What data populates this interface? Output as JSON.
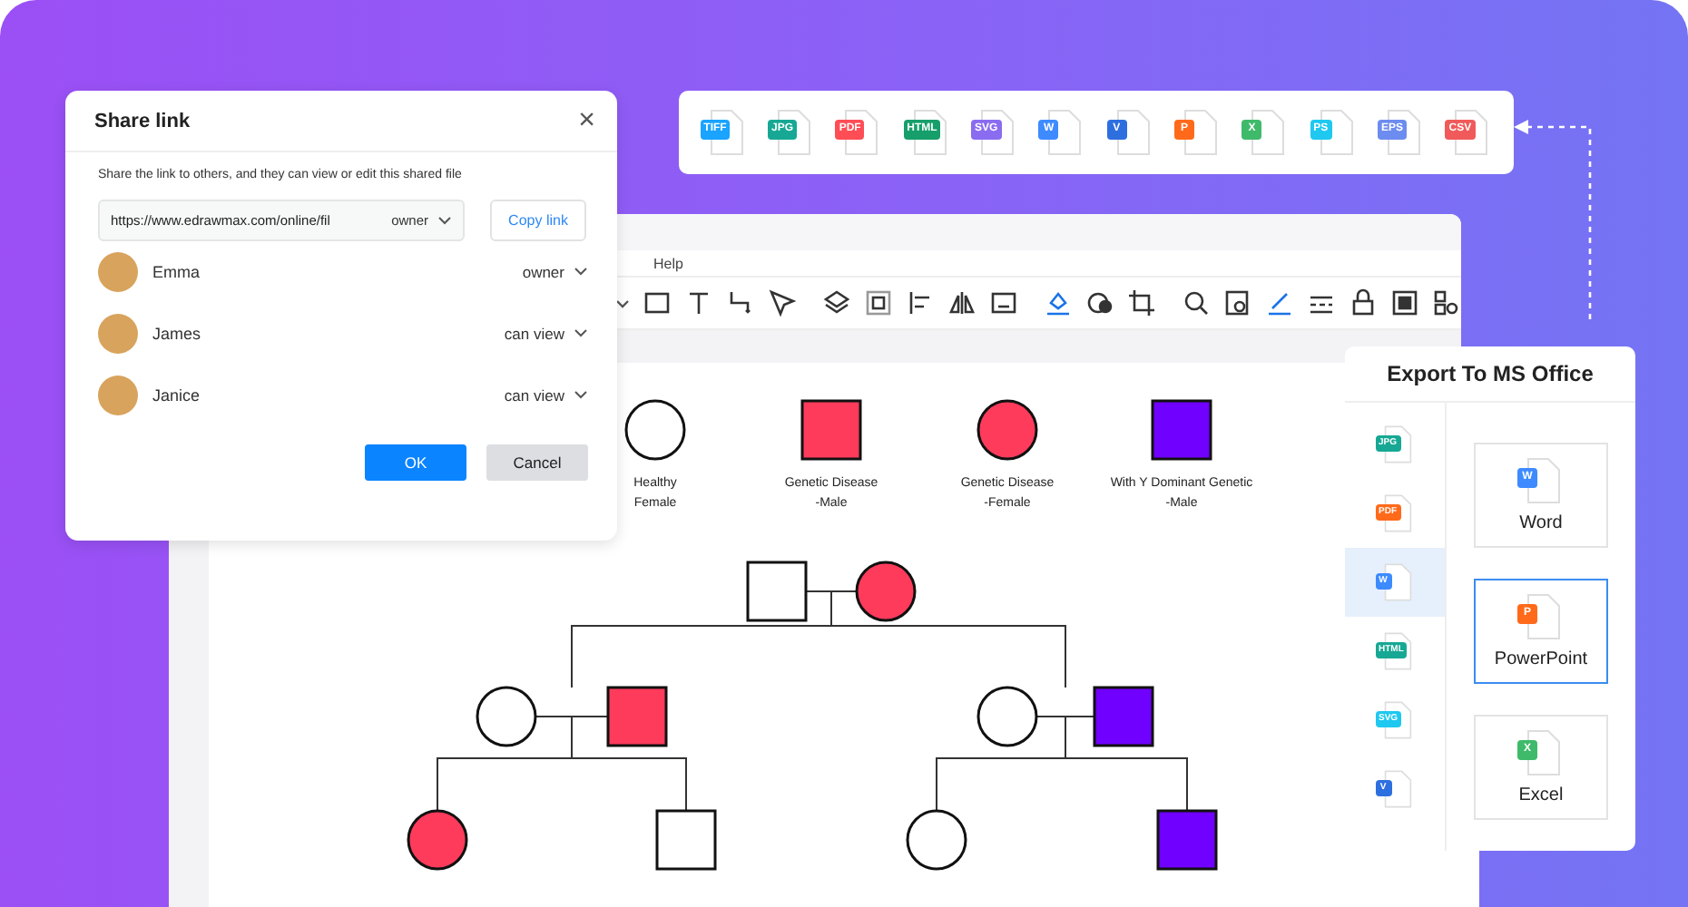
{
  "share_dialog": {
    "title": "Share link",
    "close": "×",
    "description": "Share the link to others, and they can view or edit this shared file",
    "link": {
      "value": "https://www.edrawmax.com/online/fil",
      "permission": "owner"
    },
    "copy_button": "Copy link",
    "people": [
      {
        "name": "Emma",
        "permission": "owner"
      },
      {
        "name": "James",
        "permission": "can view"
      },
      {
        "name": "Janice",
        "permission": "can view"
      }
    ],
    "ok_button": "OK",
    "cancel_button": "Cancel"
  },
  "export_formats": [
    {
      "label": "TIFF",
      "color": "#1aa3ff"
    },
    {
      "label": "JPG",
      "color": "#16a894"
    },
    {
      "label": "PDF",
      "color": "#ff4d55"
    },
    {
      "label": "HTML",
      "color": "#169e6b"
    },
    {
      "label": "SVG",
      "color": "#8a6cf0"
    },
    {
      "label": "W",
      "color": "#3d8bff"
    },
    {
      "label": "V",
      "color": "#2e6fe0"
    },
    {
      "label": "P",
      "color": "#ff6a1a"
    },
    {
      "label": "X",
      "color": "#3fba6a"
    },
    {
      "label": "PS",
      "color": "#1ec8f0"
    },
    {
      "label": "EPS",
      "color": "#6d8cf0"
    },
    {
      "label": "CSV",
      "color": "#f05a5a"
    }
  ],
  "editor": {
    "menu": [
      "Help"
    ],
    "legend": [
      {
        "kind": "circle",
        "color": "#ffffff",
        "lines": [
          "Healthy",
          "Female"
        ]
      },
      {
        "kind": "square",
        "color": "#ff3b5c",
        "lines": [
          "Genetic Disease",
          "-Male"
        ]
      },
      {
        "kind": "circle",
        "color": "#ff3b5c",
        "lines": [
          "Genetic Disease",
          "-Female"
        ]
      },
      {
        "kind": "square",
        "color": "#7000ff",
        "lines": [
          "With Y Dominant Genetic",
          "-Male"
        ]
      }
    ],
    "pedigree": [
      {
        "kind": "square",
        "color": "#ffffff"
      },
      {
        "kind": "circle",
        "color": "#ff3b5c"
      },
      {
        "kind": "circle",
        "color": "#ffffff"
      },
      {
        "kind": "square",
        "color": "#ff3b5c"
      },
      {
        "kind": "circle",
        "color": "#ffffff"
      },
      {
        "kind": "square",
        "color": "#7000ff"
      },
      {
        "kind": "circle",
        "color": "#ff3b5c"
      },
      {
        "kind": "square",
        "color": "#ffffff"
      },
      {
        "kind": "circle",
        "color": "#ffffff"
      },
      {
        "kind": "square",
        "color": "#7000ff"
      }
    ]
  },
  "export_panel": {
    "title": "Export To MS Office",
    "formats": [
      {
        "label": "JPG",
        "color": "#16a894",
        "selected": false
      },
      {
        "label": "PDF",
        "color": "#ff6a1a",
        "selected": false
      },
      {
        "label": "W",
        "color": "#3d8bff",
        "selected": true
      },
      {
        "label": "HTML",
        "color": "#16a894",
        "selected": false
      },
      {
        "label": "SVG",
        "color": "#1ec8f0",
        "selected": false
      },
      {
        "label": "V",
        "color": "#2e6fe0",
        "selected": false
      }
    ],
    "options": [
      {
        "letter": "W",
        "label": "Word",
        "color": "#3d8bff",
        "selected": false
      },
      {
        "letter": "P",
        "label": "PowerPoint",
        "color": "#ff6a1a",
        "selected": true
      },
      {
        "letter": "X",
        "label": "Excel",
        "color": "#3fba6a",
        "selected": false
      }
    ]
  }
}
